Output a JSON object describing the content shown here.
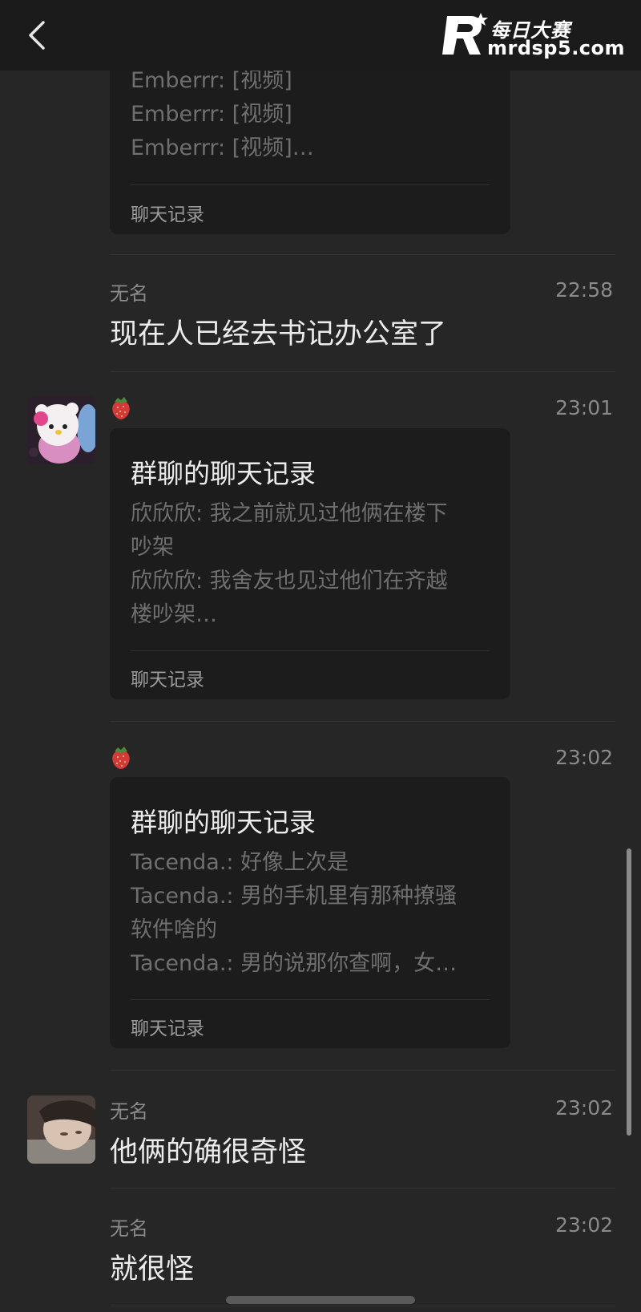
{
  "header": {
    "back_icon": "chevron-left-icon",
    "watermark": {
      "cn": "每日大赛",
      "url": "mrdsp5.com"
    }
  },
  "messages": [
    {
      "type": "chat-record-card",
      "lines": [
        "Emberrr: [视频]",
        "Emberrr: [视频]",
        "Emberrr: [视频]…"
      ],
      "footer": "聊天记录"
    },
    {
      "type": "text",
      "sender": "无名",
      "time": "22:58",
      "text": "现在人已经去书记办公室了"
    },
    {
      "type": "chat-record-card",
      "sender_icon": "strawberry-icon",
      "time": "23:01",
      "title": "群聊的聊天记录",
      "lines": [
        "欣欣欣: 我之前就见过他俩在楼下",
        "吵架",
        "欣欣欣: 我舍友也见过他们在齐越",
        "楼吵架…"
      ],
      "footer": "聊天记录"
    },
    {
      "type": "chat-record-card",
      "sender_icon": "strawberry-icon",
      "time": "23:02",
      "title": "群聊的聊天记录",
      "lines": [
        "Tacenda.: 好像上次是",
        "Tacenda.: 男的手机里有那种撩骚",
        "软件啥的",
        "Tacenda.: 男的说那你查啊，女…"
      ],
      "footer": "聊天记录"
    },
    {
      "type": "text",
      "sender": "无名",
      "time": "23:02",
      "text": "他俩的确很奇怪"
    },
    {
      "type": "text",
      "sender": "无名",
      "time": "23:02",
      "text": "就很怪"
    }
  ],
  "colors": {
    "background": "#262626",
    "card": "#1c1c1c",
    "topbar": "#1b1b1b",
    "strawberry": "#d43a3a"
  }
}
